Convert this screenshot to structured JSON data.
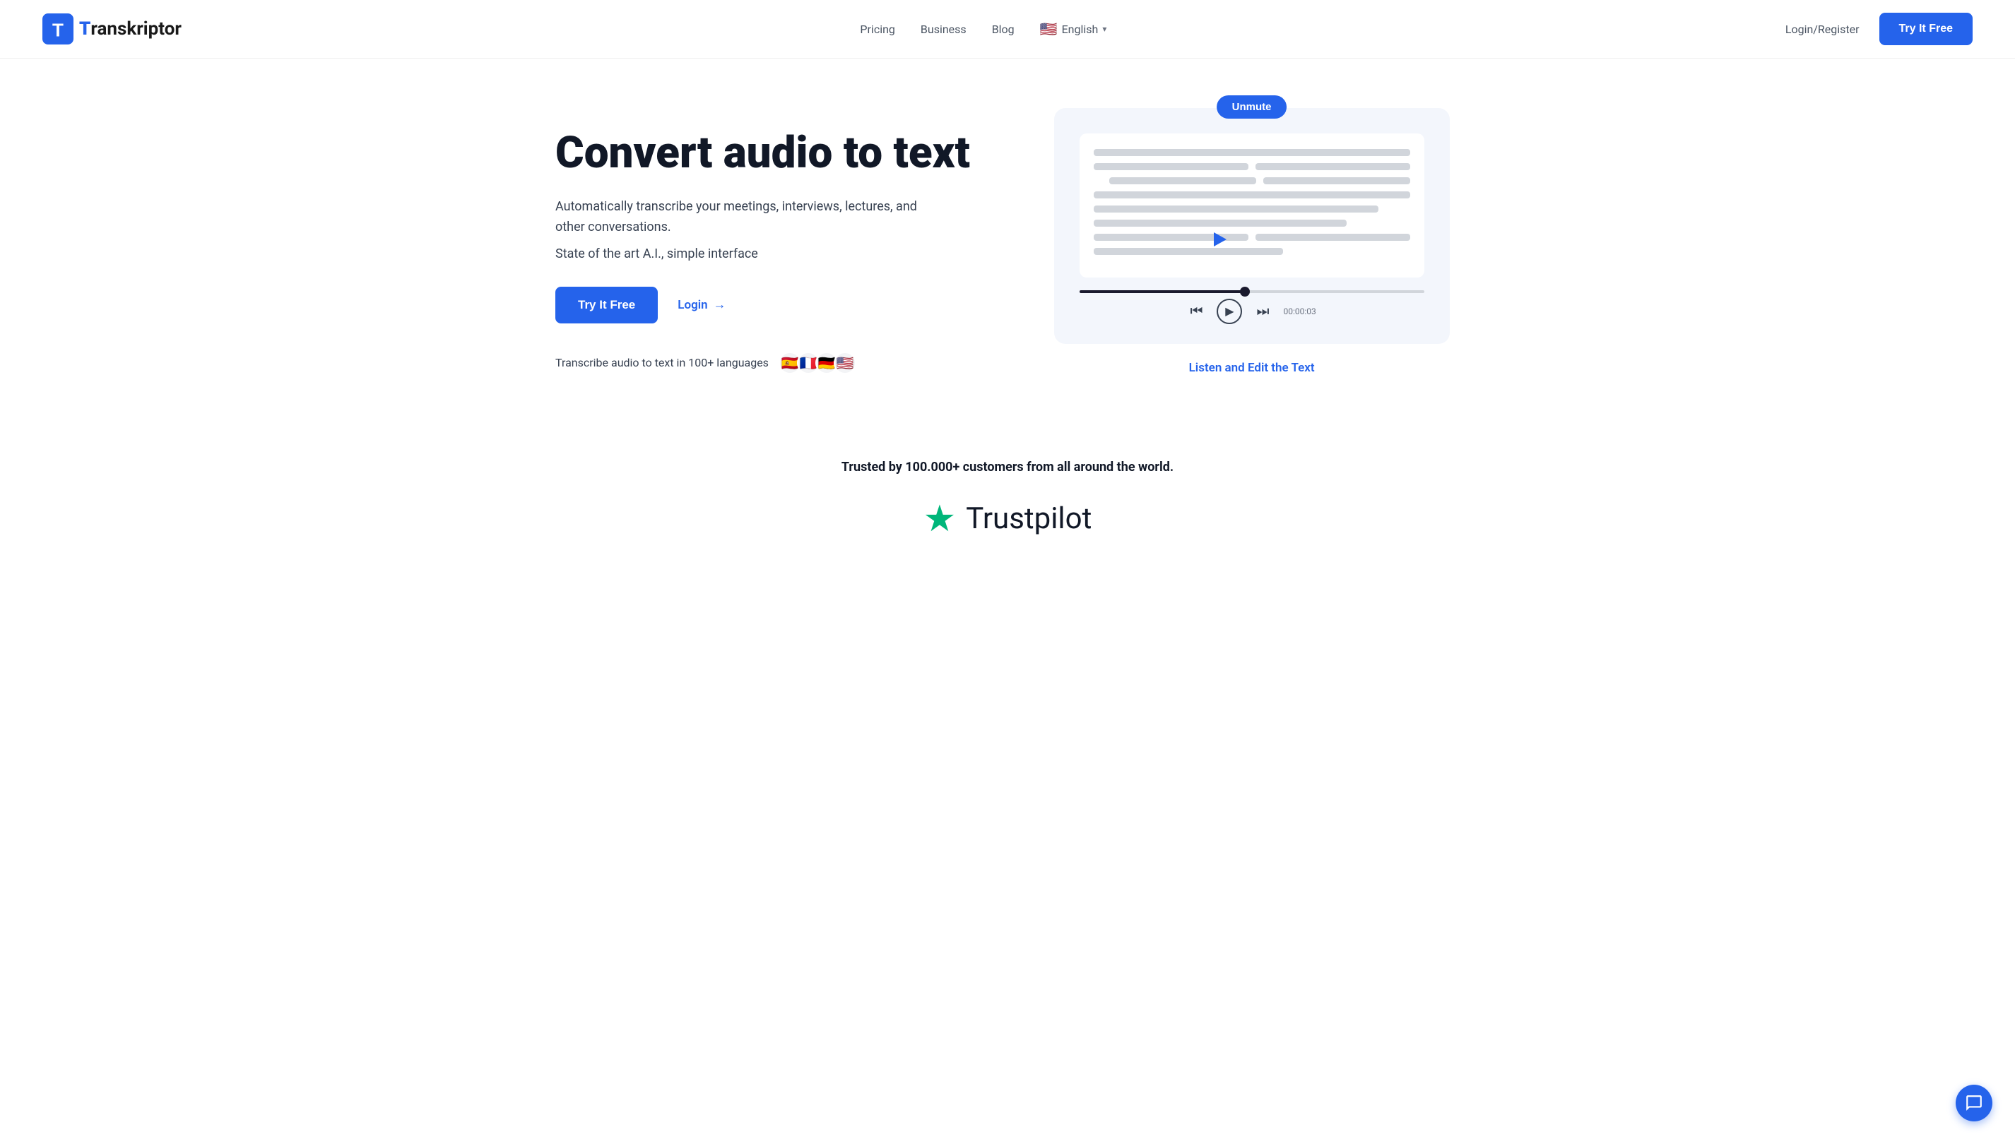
{
  "navbar": {
    "logo_text": "Transkriptor",
    "logo_t": "T",
    "nav_items": [
      {
        "label": "Pricing",
        "id": "pricing"
      },
      {
        "label": "Business",
        "id": "business"
      },
      {
        "label": "Blog",
        "id": "blog"
      }
    ],
    "language": {
      "flag": "🇺🇸",
      "label": "English",
      "chevron": "▾"
    },
    "login_label": "Login/Register",
    "try_it_free_label": "Try It Free"
  },
  "hero": {
    "title": "Convert audio to text",
    "subtitle": "Automatically transcribe your meetings, interviews, lectures, and other conversations.",
    "feature": "State of the art A.I., simple interface",
    "try_free_label": "Try It Free",
    "login_label": "Login",
    "login_arrow": "→",
    "languages_text": "Transcribe audio to text in 100+ languages",
    "flags": [
      "🇪🇸",
      "🇫🇷",
      "🇩🇪",
      "🇺🇸"
    ]
  },
  "demo": {
    "unmute_label": "Unmute",
    "listen_edit_label": "Listen and Edit the Text",
    "timestamp": "00:00:03",
    "progress_percent": 48
  },
  "trust": {
    "text": "Trusted by 100.000+ customers from all around the world.",
    "trustpilot_label": "Trustpilot",
    "trustpilot_star": "★"
  },
  "chat": {
    "icon_label": "chat-icon"
  }
}
